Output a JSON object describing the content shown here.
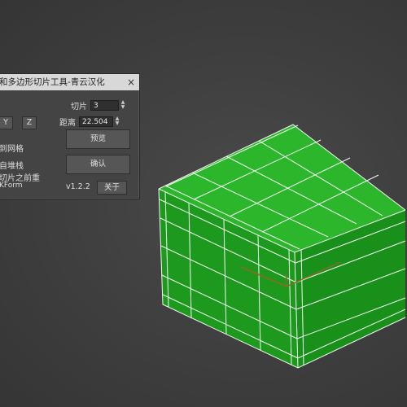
{
  "dialog": {
    "title": "和多边形切片工具-青云汉化",
    "close_glyph": "×",
    "y_button": "Y",
    "z_button": "Z",
    "slices_label": "切片",
    "slices_value": "3",
    "distance_label": "距离",
    "distance_value": "22.504",
    "preview_button": "预览",
    "confirm_button": "确认",
    "checkbox1_label": "到网格",
    "checkbox2_label": "自堆栈",
    "checkbox3_label": "切片之前重",
    "checkbox3_sub": "KForm",
    "version": "v1.2.2",
    "about_button": "关于"
  },
  "viewport": {
    "background_color": "#3f3f3f",
    "box_color": "#22a822",
    "wire_color": "#ffffff",
    "gizmo_color": "#8a6a2a"
  }
}
